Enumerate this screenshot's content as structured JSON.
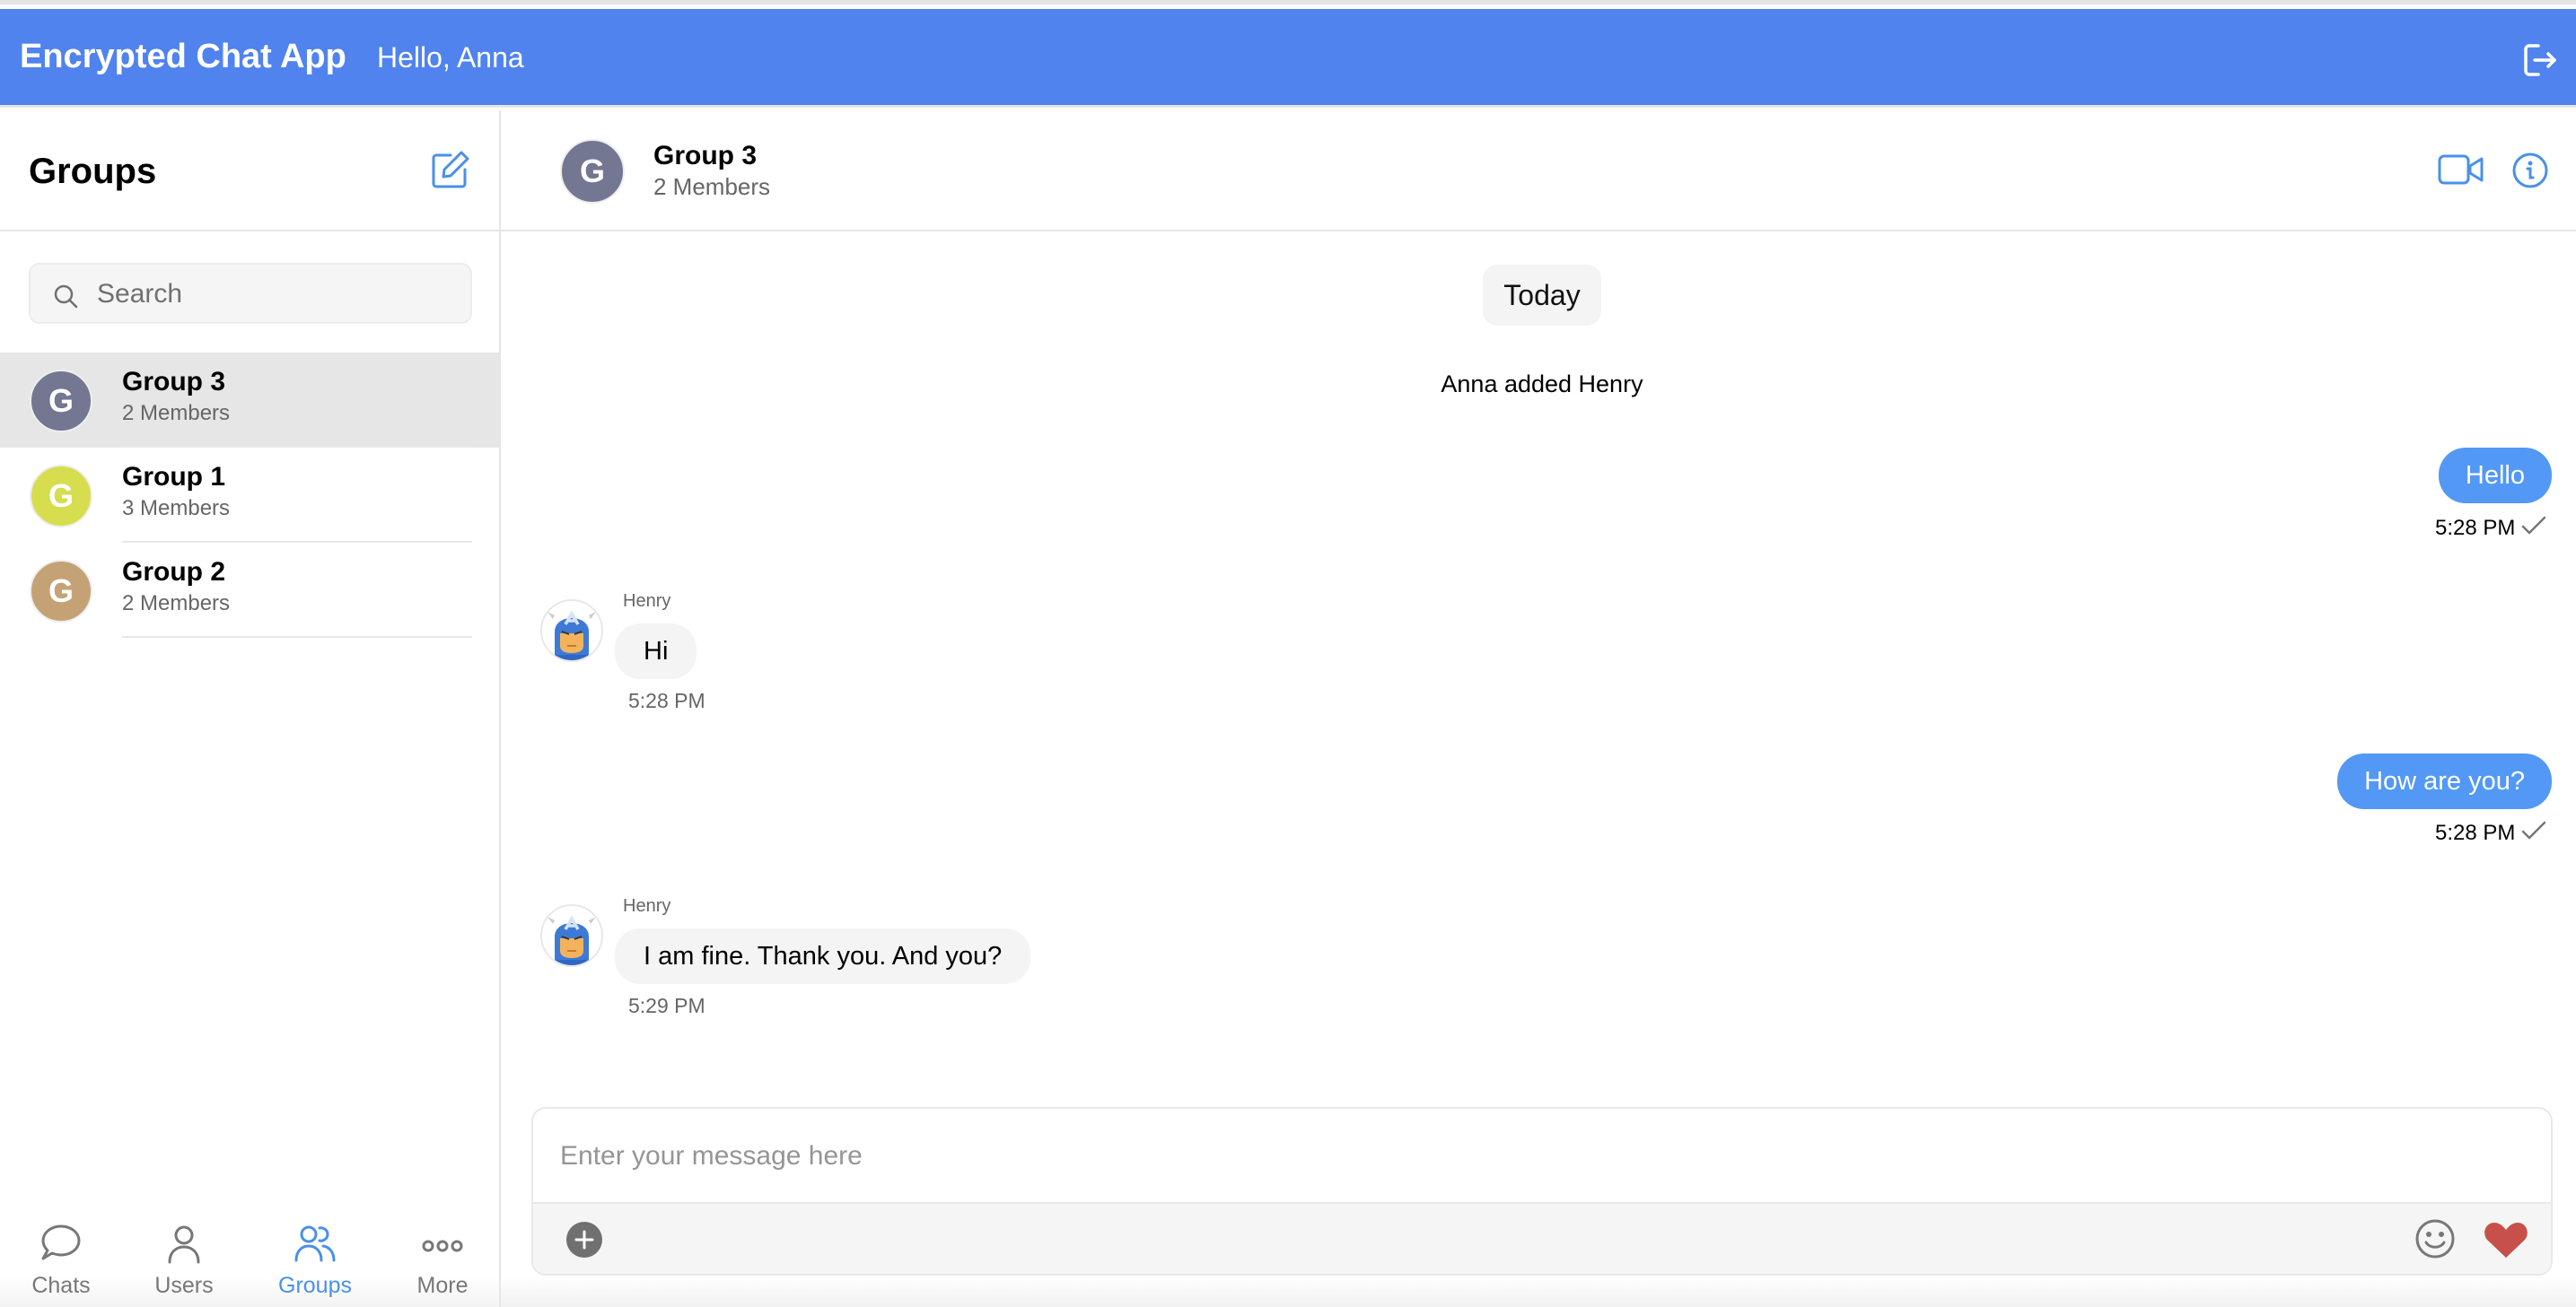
{
  "topbar": {
    "app_title": "Encrypted Chat App",
    "greeting": "Hello, Anna",
    "logout_icon": "logout-icon",
    "color": "#5083ee"
  },
  "sidebar": {
    "title": "Groups",
    "compose_icon": "compose-icon",
    "search": {
      "placeholder": "Search",
      "value": ""
    },
    "groups": [
      {
        "initial": "G",
        "name": "Group 3",
        "members": "2 Members",
        "color": "#737791",
        "active": true
      },
      {
        "initial": "G",
        "name": "Group 1",
        "members": "3 Members",
        "color": "#d6dd4f",
        "active": false
      },
      {
        "initial": "G",
        "name": "Group 2",
        "members": "2 Members",
        "color": "#c5a276",
        "active": false
      }
    ],
    "nav": [
      {
        "label": "Chats",
        "icon": "chat-bubble-icon",
        "active": false
      },
      {
        "label": "Users",
        "icon": "user-icon",
        "active": false
      },
      {
        "label": "Groups",
        "icon": "users-group-icon",
        "active": true
      },
      {
        "label": "More",
        "icon": "more-dots-icon",
        "active": false
      }
    ]
  },
  "chat": {
    "header": {
      "initial": "G",
      "title": "Group 3",
      "subtitle": "2 Members",
      "video_icon": "video-call-icon",
      "info_icon": "info-icon"
    },
    "day_label": "Today",
    "system_message": "Anna added Henry",
    "messages": [
      {
        "direction": "out",
        "text": "Hello",
        "time": "5:28 PM",
        "status": "sent"
      },
      {
        "direction": "in",
        "sender": "Henry",
        "text": "Hi",
        "time": "5:28 PM"
      },
      {
        "direction": "out",
        "text": "How are you?",
        "time": "5:28 PM",
        "status": "sent"
      },
      {
        "direction": "in",
        "sender": "Henry",
        "text": "I am fine. Thank you. And you?",
        "time": "5:29 PM"
      }
    ],
    "composer": {
      "placeholder": "Enter your message here",
      "value": "",
      "accent_out": "#5398f5",
      "heart_color": "#c8504a"
    }
  }
}
